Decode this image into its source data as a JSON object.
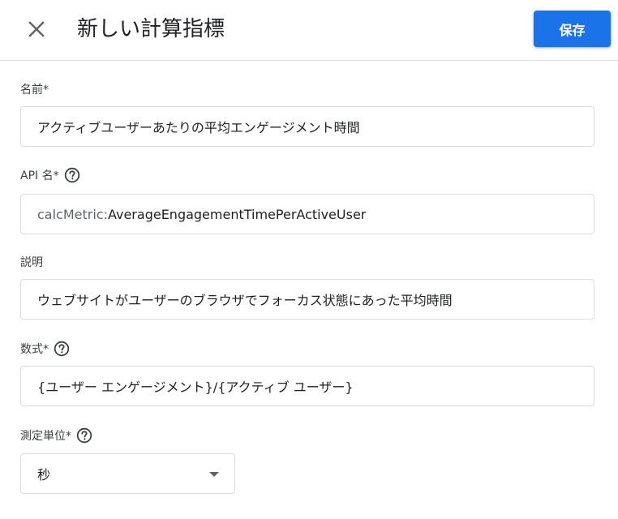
{
  "header": {
    "title": "新しい計算指標",
    "save_label": "保存",
    "close_icon": "close-icon"
  },
  "fields": {
    "name": {
      "label": "名前*",
      "value": "アクティブユーザーあたりの平均エンゲージメント時間"
    },
    "api_name": {
      "label": "API 名*",
      "prefix": "calcMetric:",
      "value": "AverageEngagementTimePerActiveUser",
      "help_icon": "help-icon"
    },
    "description": {
      "label": "説明",
      "value": "ウェブサイトがユーザーのブラウザでフォーカス状態にあった平均時間"
    },
    "formula": {
      "label": "数式*",
      "value": "{ユーザー エンゲージメント}/{アクティブ ユーザー}",
      "help_icon": "help-icon"
    },
    "unit": {
      "label": "測定単位*",
      "selected": "秒",
      "help_icon": "help-icon"
    }
  },
  "colors": {
    "accent": "#1a73e8",
    "border": "#dadce0",
    "text": "#202124",
    "secondary_text": "#5f6368"
  }
}
